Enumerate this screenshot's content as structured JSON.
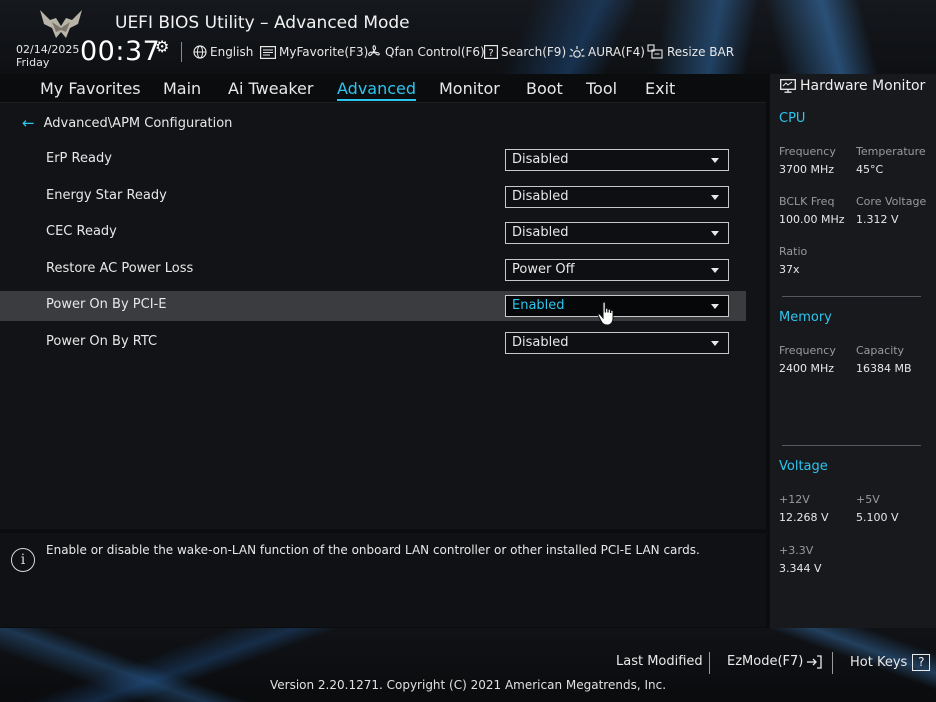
{
  "header": {
    "title": "UEFI BIOS Utility – Advanced Mode",
    "date": "02/14/2025",
    "day": "Friday",
    "time": "00:37",
    "toolbar": [
      {
        "label": "English",
        "icon": "globe-icon"
      },
      {
        "label": "MyFavorite(F3)",
        "icon": "favorite-icon"
      },
      {
        "label": "Qfan Control(F6)",
        "icon": "fan-icon"
      },
      {
        "label": "Search(F9)",
        "icon": "search-help-icon"
      },
      {
        "label": "AURA(F4)",
        "icon": "aura-light-icon"
      },
      {
        "label": "Resize BAR",
        "icon": "resize-bar-icon"
      }
    ]
  },
  "tabs": [
    {
      "label": "My Favorites"
    },
    {
      "label": "Main"
    },
    {
      "label": "Ai Tweaker"
    },
    {
      "label": "Advanced",
      "active": true
    },
    {
      "label": "Monitor"
    },
    {
      "label": "Boot"
    },
    {
      "label": "Tool"
    },
    {
      "label": "Exit"
    }
  ],
  "breadcrumb": "Advanced\\APM Configuration",
  "settings": [
    {
      "label": "ErP Ready",
      "value": "Disabled"
    },
    {
      "label": "Energy Star Ready",
      "value": "Disabled"
    },
    {
      "label": "CEC Ready",
      "value": "Disabled"
    },
    {
      "label": "Restore AC Power Loss",
      "value": "Power Off"
    },
    {
      "label": "Power On By PCI-E",
      "value": "Enabled",
      "selected": true
    },
    {
      "label": "Power On By RTC",
      "value": "Disabled"
    }
  ],
  "help_text": "Enable or disable the wake-on-LAN function of the onboard LAN controller or other installed PCI-E LAN cards.",
  "hardware_monitor": {
    "title": "Hardware Monitor",
    "cpu": {
      "section": "CPU",
      "frequency_label": "Frequency",
      "frequency": "3700 MHz",
      "temperature_label": "Temperature",
      "temperature": "45°C",
      "bclk_label": "BCLK Freq",
      "bclk": "100.00 MHz",
      "core_voltage_label": "Core Voltage",
      "core_voltage": "1.312 V",
      "ratio_label": "Ratio",
      "ratio": "37x"
    },
    "memory": {
      "section": "Memory",
      "frequency_label": "Frequency",
      "frequency": "2400 MHz",
      "capacity_label": "Capacity",
      "capacity": "16384 MB"
    },
    "voltage": {
      "section": "Voltage",
      "v12_label": "+12V",
      "v12": "12.268 V",
      "v5_label": "+5V",
      "v5": "5.100 V",
      "v33_label": "+3.3V",
      "v33": "3.344 V"
    }
  },
  "footer": {
    "last_modified": "Last Modified",
    "ezmode": "EzMode(F7)",
    "hotkeys": "Hot Keys",
    "hotkeys_icon_glyph": "?",
    "copyright": "Version 2.20.1271. Copyright (C) 2021 American Megatrends, Inc."
  },
  "colors": {
    "accent": "#2ec5ee",
    "background": "#121316",
    "selected_row": "#3a3c40"
  }
}
